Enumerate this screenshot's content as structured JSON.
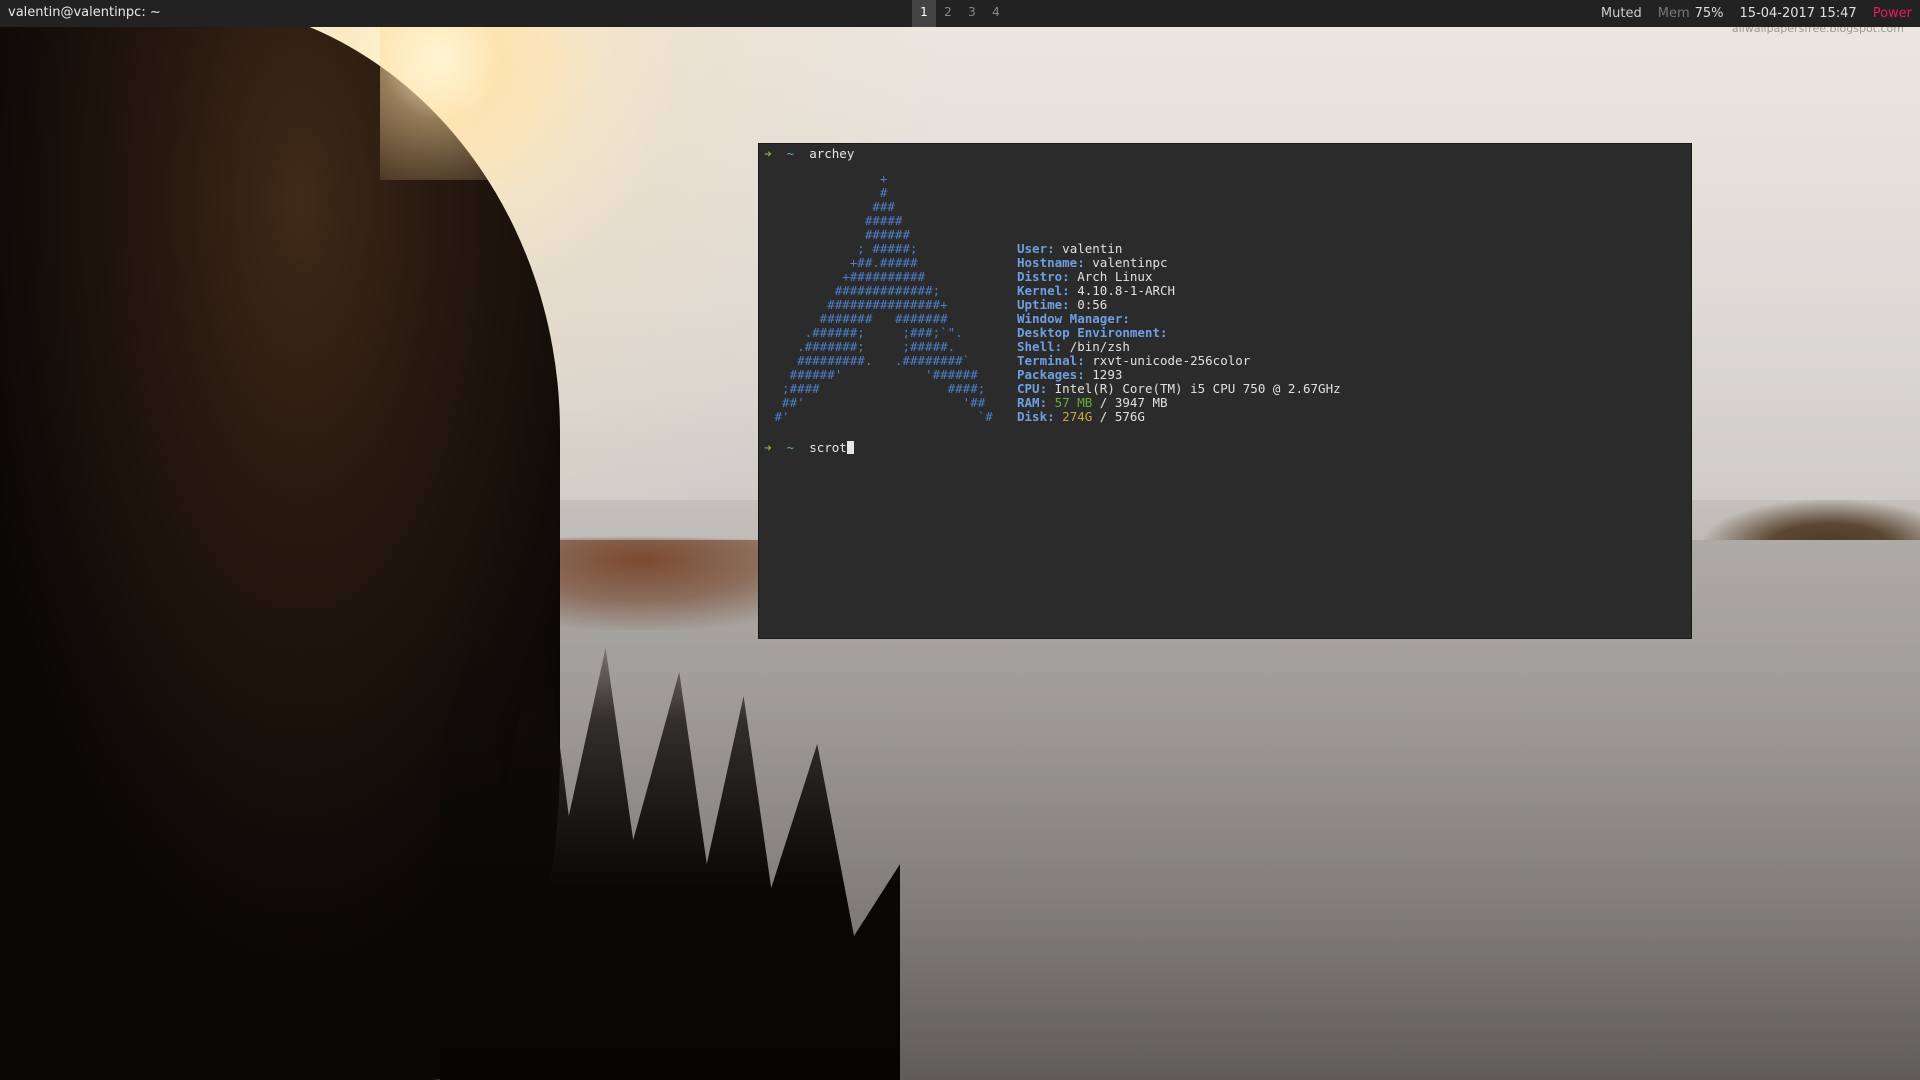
{
  "topbar": {
    "window_title": "valentin@valentinpc: ~",
    "workspaces": [
      "1",
      "2",
      "3",
      "4"
    ],
    "active_workspace": "1",
    "volume": "Muted",
    "mem_label": "Mem",
    "mem_value": "75%",
    "datetime": "15-04-2017 15:47",
    "power": "Power"
  },
  "wallpaper": {
    "watermark": "allwallpapersfree.blogspot.com"
  },
  "terminal": {
    "prompt_arrow": "➜",
    "prompt_dir": "~",
    "command1": "archey",
    "command2": "scrot",
    "ascii_art": [
      "               +",
      "               #",
      "              ###",
      "             #####",
      "             ######",
      "            ; #####;",
      "           +##.#####",
      "          +##########",
      "         #############;",
      "        ###############+",
      "       #######   #######",
      "     .######;     ;###;`\".",
      "    .#######;     ;#####.",
      "    #########.   .########`",
      "   ######'           '######",
      "  ;####                 ####;",
      "  ##'                     '##",
      " #'                         `#"
    ],
    "info": [
      {
        "key": "User:",
        "value": "valentin"
      },
      {
        "key": "Hostname:",
        "value": "valentinpc"
      },
      {
        "key": "Distro:",
        "value": "Arch Linux"
      },
      {
        "key": "Kernel:",
        "value": "4.10.8-1-ARCH"
      },
      {
        "key": "Uptime:",
        "value": "0:56"
      },
      {
        "key": "Window Manager:",
        "value": ""
      },
      {
        "key": "Desktop Environment:",
        "value": ""
      },
      {
        "key": "Shell:",
        "value": "/bin/zsh"
      },
      {
        "key": "Terminal:",
        "value": "rxvt-unicode-256color"
      },
      {
        "key": "Packages:",
        "value": "1293"
      },
      {
        "key": "CPU:",
        "value": "Intel(R) Core(TM) i5 CPU 750 @ 2.67GHz"
      }
    ],
    "ram": {
      "key": "RAM:",
      "used": "57 MB",
      "sep": " / ",
      "total": "3947 MB"
    },
    "disk": {
      "key": "Disk:",
      "used": "274G",
      "sep": " / ",
      "total": "576G"
    }
  },
  "colors": {
    "bar_bg": "#222222",
    "terminal_bg": "#2b2b2b",
    "art_blue": "#4f7ec7",
    "key_blue": "#6f9fe0",
    "power_red": "#e0205a",
    "ram_green": "#6bab3e",
    "disk_yellow": "#c8a83a"
  }
}
